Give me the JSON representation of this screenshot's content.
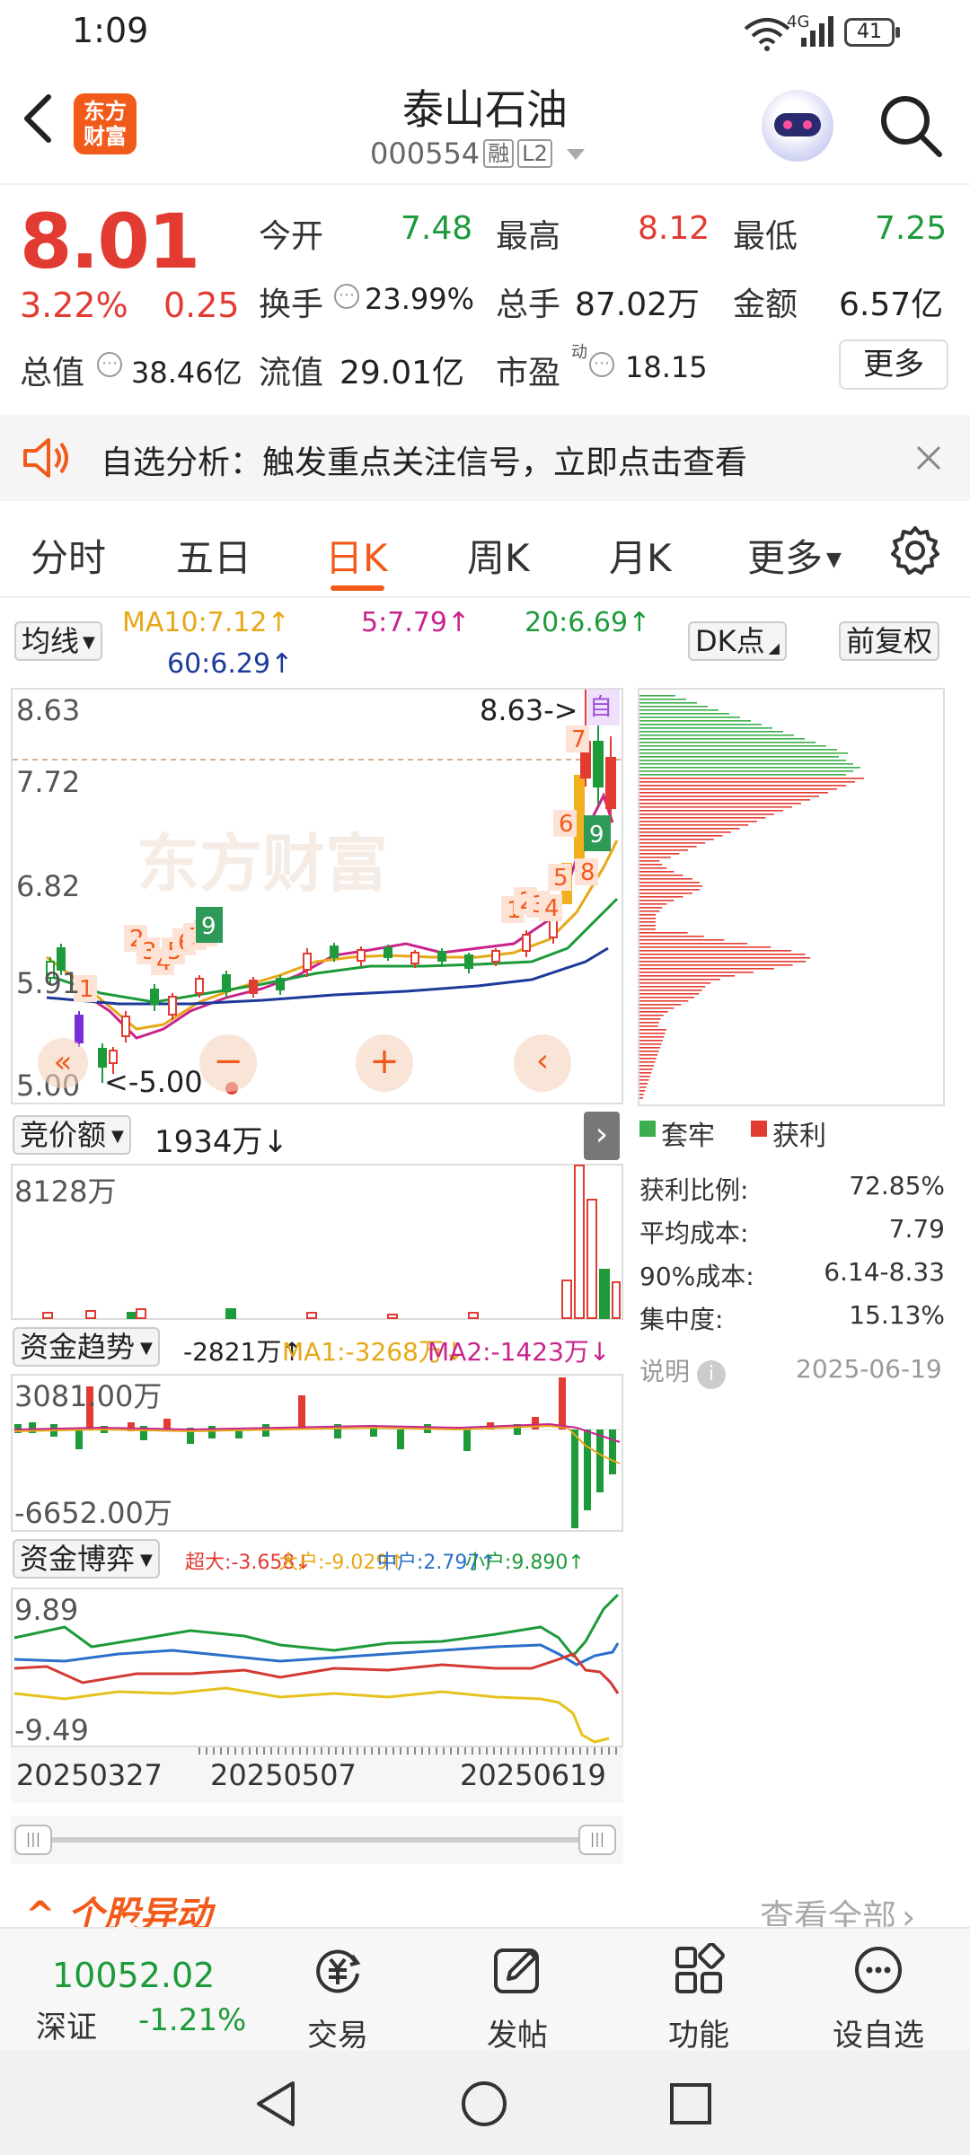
{
  "status_bar": {
    "time": "1:09",
    "network": "4G",
    "battery": "41"
  },
  "header": {
    "logo_line1": "东方",
    "logo_line2": "财富",
    "stock_name": "泰山石油",
    "stock_code": "000554",
    "tag_margin": "融",
    "tag_level": "L2"
  },
  "quote": {
    "price": "8.01",
    "change_pct": "3.22%",
    "change_amt": "0.25",
    "open_label": "今开",
    "open": "7.48",
    "high_label": "最高",
    "high": "8.12",
    "low_label": "最低",
    "low": "7.25",
    "turnover_label": "换手",
    "turnover": "23.99%",
    "volume_label": "总手",
    "volume": "87.02万",
    "amount_label": "金额",
    "amount": "6.57亿",
    "mktcap_label": "总值",
    "mktcap": "38.46亿",
    "float_label": "流值",
    "float": "29.01亿",
    "pe_label": "市盈",
    "pe_sup": "动",
    "pe": "18.15",
    "more_label": "更多"
  },
  "banner": {
    "text": "自选分析：触发重点关注信号，立即点击查看"
  },
  "tabs": [
    "分时",
    "五日",
    "日K",
    "周K",
    "月K",
    "更多"
  ],
  "active_tab": "日K",
  "kline": {
    "ma_selector": "均线",
    "ma10": "MA10:7.12↑",
    "ma5": "5:7.79↑",
    "ma20": "20:6.69↑",
    "ma60": "60:6.29↑",
    "dk_btn": "DK点",
    "adj_btn": "前复权",
    "price_labels": [
      "8.63",
      "7.72",
      "6.82",
      "5.91",
      "5.00"
    ],
    "high_marker": "8.63->",
    "low_marker": "<-5.00",
    "self_tag": "自",
    "seq_numbers_a": [
      "1",
      "2",
      "3",
      "4",
      "5",
      "6",
      "7",
      "8",
      "9"
    ],
    "seq_numbers_b": [
      "1",
      "2",
      "3",
      "4",
      "5",
      "6",
      "7",
      "8",
      "9"
    ],
    "watermark": "东方财富",
    "colors": {
      "up": "#e23b32",
      "down": "#1d9a3a",
      "ma5": "#c8248c",
      "ma10": "#e6a817",
      "ma20": "#1d9a3a",
      "ma60": "#1c3a9a"
    }
  },
  "auction": {
    "selector": "竞价额",
    "value": "1934万↓",
    "max_label": "8128万"
  },
  "fund_trend": {
    "selector": "资金趋势",
    "value": "-2821万↑",
    "ma1": "MA1:-3268万↓",
    "ma2": "MA2:-1423万↓",
    "top_label": "3081.00万",
    "bottom_label": "-6652.00万"
  },
  "fund_game": {
    "selector": "资金博弈",
    "super": "超大:-3.658↓",
    "big": "大户:-9.029↑",
    "mid": "中户:2.797↑",
    "small": "小户:9.890↑",
    "top_label": "9.89",
    "bottom_label": "-9.49"
  },
  "dates": [
    "20250327",
    "20250507",
    "20250619"
  ],
  "profit": {
    "legend_trapped": "套牢",
    "legend_profit": "获利",
    "rows": [
      {
        "label": "获利比例:",
        "value": "72.85%"
      },
      {
        "label": "平均成本:",
        "value": "7.79"
      },
      {
        "label": "90%成本:",
        "value": "6.14-8.33"
      },
      {
        "label": "集中度:",
        "value": "15.13%"
      }
    ],
    "note_label": "说明",
    "date": "2025-06-19"
  },
  "movement": {
    "title": "个股异动",
    "view_all": "查看全部"
  },
  "bottom_bar": {
    "index_value": "10052.02",
    "index_name": "深证",
    "index_change": "-1.21%",
    "items": [
      "交易",
      "发帖",
      "功能",
      "设自选"
    ]
  }
}
